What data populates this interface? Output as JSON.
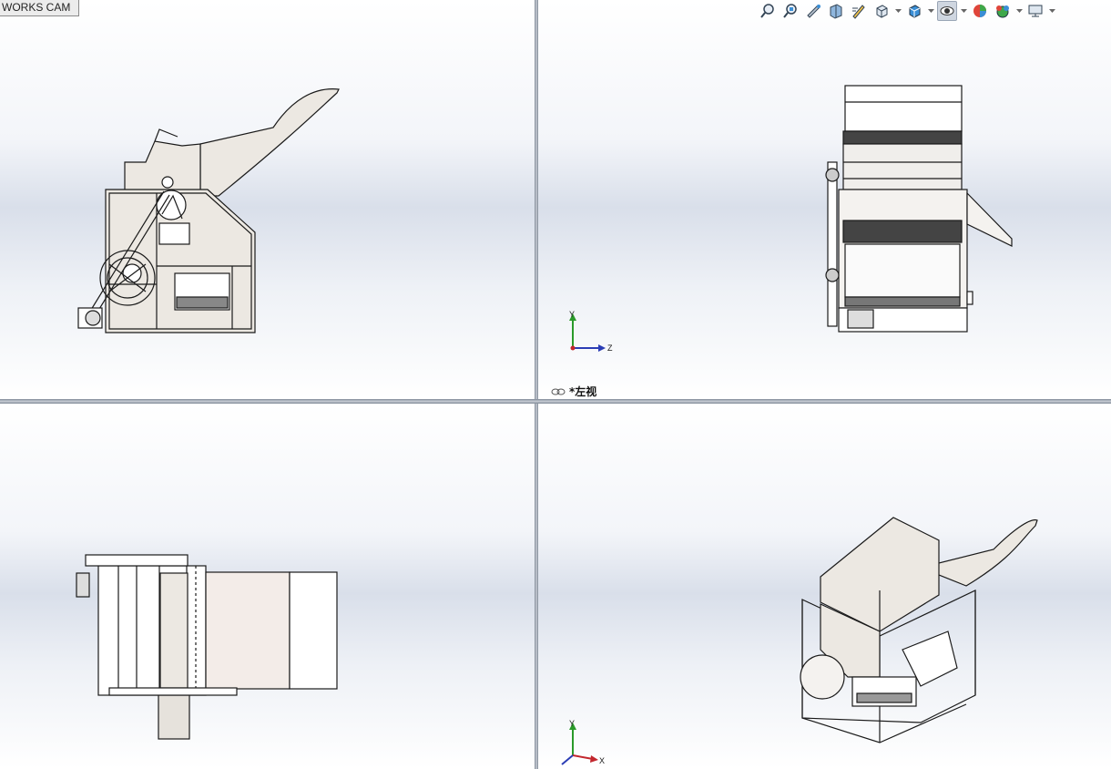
{
  "tab": {
    "label": "WORKS CAM"
  },
  "toolbar": {
    "tools": [
      {
        "name": "zoom-to-fit-icon"
      },
      {
        "name": "zoom-to-area-icon"
      },
      {
        "name": "previous-view-icon"
      },
      {
        "name": "section-view-icon"
      },
      {
        "name": "dynamic-annotation-icon"
      },
      {
        "name": "view-orientation-icon"
      },
      {
        "name": "display-style-icon"
      },
      {
        "name": "hide-show-items-icon"
      },
      {
        "name": "edit-appearance-icon"
      },
      {
        "name": "apply-scene-icon"
      },
      {
        "name": "view-settings-icon"
      }
    ]
  },
  "viewports": {
    "top_right": {
      "view_label": "*左视"
    }
  },
  "triad": {
    "y": "Y",
    "z": "Z",
    "x": "X"
  },
  "colors": {
    "accent": "#3b8fd6",
    "part_fill": "#ece8e2",
    "edge": "#1a1a1a"
  }
}
